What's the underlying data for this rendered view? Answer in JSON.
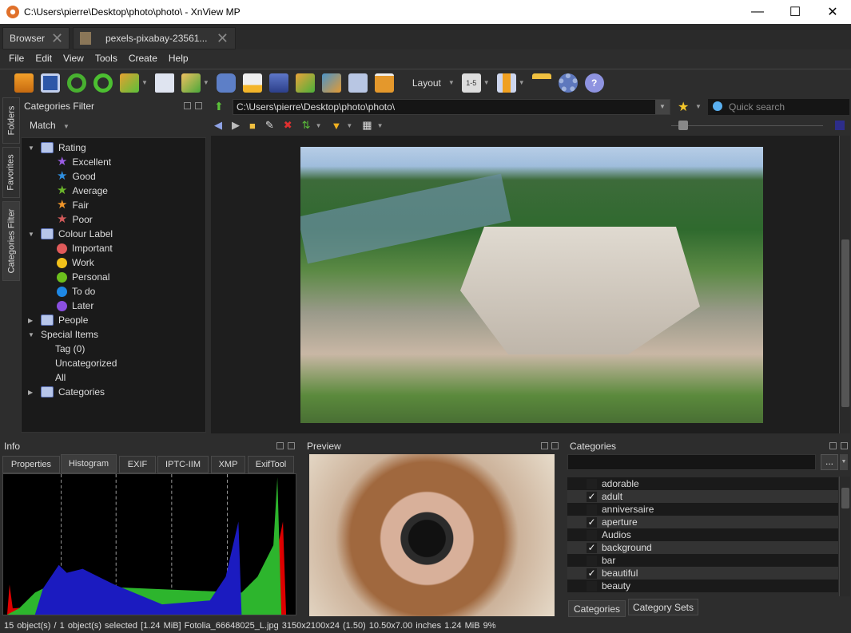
{
  "window": {
    "title": "C:\\Users\\pierre\\Desktop\\photo\\photo\\ - XnView MP",
    "minimize": "—",
    "maximize": "☐",
    "close": "✕"
  },
  "tabs": [
    {
      "label": "Browser"
    },
    {
      "label": "pexels-pixabay-23561..."
    }
  ],
  "menu": [
    {
      "label": "File"
    },
    {
      "label": "Edit"
    },
    {
      "label": "View"
    },
    {
      "label": "Tools"
    },
    {
      "label": "Create"
    },
    {
      "label": "Help"
    }
  ],
  "toolbar": {
    "layout_label": "Layout",
    "icons": [
      "view-icon",
      "fullscreen-icon",
      "refresh-icon",
      "rotate-icon",
      "convert-icon",
      "properties-icon",
      "move-copy-icon",
      "find-icon",
      "print-icon",
      "scan-icon",
      "batch-icon",
      "compare-icon",
      "capture-icon",
      "slideshow-icon"
    ],
    "rating_badge": "1-5"
  },
  "sidebar": {
    "vertical_tabs": [
      "Folders",
      "Favorites",
      "Categories Filter"
    ],
    "panel_title": "Categories Filter",
    "match_label": "Match",
    "tree": [
      {
        "label": "Rating",
        "level": 0,
        "expanded": true,
        "icon": "rating-icon"
      },
      {
        "label": "Excellent",
        "level": 1,
        "icon": "star",
        "color": "#9b5de5"
      },
      {
        "label": "Good",
        "level": 1,
        "icon": "star",
        "color": "#2f8fe0"
      },
      {
        "label": "Average",
        "level": 1,
        "icon": "star",
        "color": "#6bb52b"
      },
      {
        "label": "Fair",
        "level": 1,
        "icon": "star",
        "color": "#f0962a"
      },
      {
        "label": "Poor",
        "level": 1,
        "icon": "star",
        "color": "#d25a5a"
      },
      {
        "label": "Colour Label",
        "level": 0,
        "expanded": true,
        "icon": "colour-label-icon"
      },
      {
        "label": "Important",
        "level": 1,
        "icon": "dot",
        "color": "#e05a5a"
      },
      {
        "label": "Work",
        "level": 1,
        "icon": "dot",
        "color": "#f2c11a"
      },
      {
        "label": "Personal",
        "level": 1,
        "icon": "dot",
        "color": "#6cbf1d"
      },
      {
        "label": "To do",
        "level": 1,
        "icon": "dot",
        "color": "#1e88e5"
      },
      {
        "label": "Later",
        "level": 1,
        "icon": "dot",
        "color": "#8a4fe0"
      },
      {
        "label": "People",
        "level": 0,
        "expanded": false,
        "icon": "people-icon"
      },
      {
        "label": "Special Items",
        "level": 0,
        "expanded": true
      },
      {
        "label": "Tag (0)",
        "level": 1
      },
      {
        "label": "Uncategorized",
        "level": 1
      },
      {
        "label": "All",
        "level": 1
      },
      {
        "label": "Categories",
        "level": 0,
        "expanded": false,
        "icon": "categories-icon"
      }
    ]
  },
  "browser": {
    "path": "C:\\Users\\pierre\\Desktop\\photo\\photo\\",
    "search_placeholder": "Quick search",
    "zoom_slider": 0.03
  },
  "info": {
    "title": "Info",
    "tabs": [
      "Properties",
      "Histogram",
      "EXIF",
      "IPTC-IIM",
      "XMP",
      "ExifTool"
    ],
    "active_tab": "Histogram"
  },
  "preview": {
    "title": "Preview"
  },
  "categories": {
    "title": "Categories",
    "more_label": "...",
    "items": [
      {
        "label": "adorable",
        "checked": false
      },
      {
        "label": "adult",
        "checked": true
      },
      {
        "label": "anniversaire",
        "checked": false
      },
      {
        "label": "aperture",
        "checked": true
      },
      {
        "label": "Audios",
        "checked": false
      },
      {
        "label": "background",
        "checked": true
      },
      {
        "label": "bar",
        "checked": false
      },
      {
        "label": "beautiful",
        "checked": true
      },
      {
        "label": "beauty",
        "checked": false
      }
    ],
    "bottom_tabs": [
      "Categories",
      "Category Sets"
    ],
    "check_mark": "✓"
  },
  "status": {
    "text": "15 object(s) / 1 object(s) selected [1.24 MiB]   Fotolia_66648025_L.jpg   3150x2100x24 (1.50)   10.50x7.00 inches   1.24 MiB   9%"
  }
}
